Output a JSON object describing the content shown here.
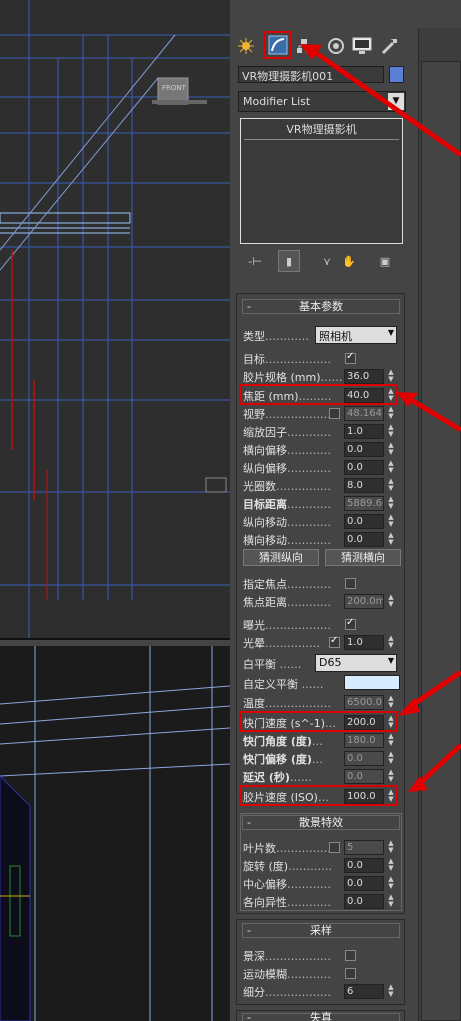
{
  "viewport": {
    "front_cube_label": "FRONT"
  },
  "panel": {
    "object_name": "VR物理摄影机001",
    "modifier_list": "Modifier List",
    "stack_item": "VR物理摄影机",
    "swatch_color": "#5b7fd4"
  },
  "tabs": [
    "create-icon",
    "modify-icon",
    "hierarchy-icon",
    "motion-icon",
    "display-icon",
    "utilities-icon"
  ],
  "basic": {
    "title": "基本参数",
    "type_label": "类型",
    "type_value": "照相机",
    "target_label": "目标",
    "film_gate_label": "胶片规格 (mm)",
    "film_gate_value": "36.0",
    "focal_label": "焦距 (mm)",
    "focal_value": "40.0",
    "fov_label": "视野",
    "fov_value": "48.164",
    "zoom_label": "缩放因子",
    "zoom_value": "1.0",
    "hshift_label": "横向偏移",
    "hshift_value": "0.0",
    "vshift_label": "纵向偏移",
    "vshift_value": "0.0",
    "fnumber_label": "光圈数",
    "fnumber_value": "8.0",
    "target_dist_label": "目标距离",
    "target_dist_value": "5889.60",
    "vtilt_label": "纵向移动",
    "vtilt_value": "0.0",
    "htilt_label": "横向移动",
    "htilt_value": "0.0",
    "guess_v": "猜测纵向",
    "guess_h": "猜测横向",
    "focus_label": "指定焦点",
    "focus_dist_label": "焦点距离",
    "focus_dist_value": "200.0m",
    "exposure_label": "曝光",
    "vignette_label": "光晕",
    "vignette_value": "1.0",
    "wb_label": "白平衡",
    "wb_value": "D65",
    "custom_wb_label": "自定义平衡",
    "temp_label": "温度",
    "temp_value": "6500.0",
    "shutter_label": "快门速度 (s^-1)",
    "shutter_value": "200.0",
    "shutter_angle_label": "快门角度 (度)",
    "shutter_angle_value": "180.0",
    "shutter_offset_label": "快门偏移 (度)",
    "shutter_offset_value": "0.0",
    "latency_label": "延迟 (秒)",
    "latency_value": "0.0",
    "iso_label": "胶片速度 (ISO)",
    "iso_value": "100.0"
  },
  "bokeh": {
    "title": "散景特效",
    "blades_label": "叶片数",
    "blades_value": "5",
    "rotation_label": "旋转 (度)",
    "rotation_value": "0.0",
    "center_bias_label": "中心偏移",
    "center_bias_value": "0.0",
    "anisotropy_label": "各向异性",
    "anisotropy_value": "0.0"
  },
  "sampling": {
    "title": "采样",
    "dof_label": "景深",
    "motion_blur_label": "运动模糊",
    "subdiv_label": "细分",
    "subdiv_value": "6"
  },
  "distortion": {
    "title": "失真"
  }
}
